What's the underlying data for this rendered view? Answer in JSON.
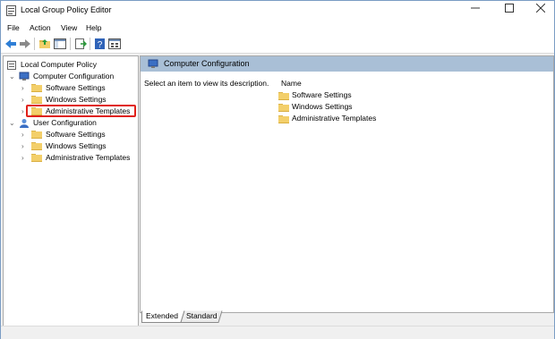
{
  "window": {
    "title": "Local Group Policy Editor"
  },
  "menu": [
    "File",
    "Action",
    "View",
    "Help"
  ],
  "tree": {
    "root": "Local Computer Policy",
    "computer": {
      "label": "Computer Configuration",
      "children": [
        "Software Settings",
        "Windows Settings",
        "Administrative Templates"
      ]
    },
    "user": {
      "label": "User Configuration",
      "children": [
        "Software Settings",
        "Windows Settings",
        "Administrative Templates"
      ]
    }
  },
  "right": {
    "header": "Computer Configuration",
    "description": "Select an item to view its description.",
    "column_name": "Name",
    "items": [
      "Software Settings",
      "Windows Settings",
      "Administrative Templates"
    ]
  },
  "tabs": [
    "Extended",
    "Standard"
  ],
  "colors": {
    "header_bg": "#a9bfd6",
    "highlight": "#e0211a",
    "folder": "#f3cf6a"
  }
}
